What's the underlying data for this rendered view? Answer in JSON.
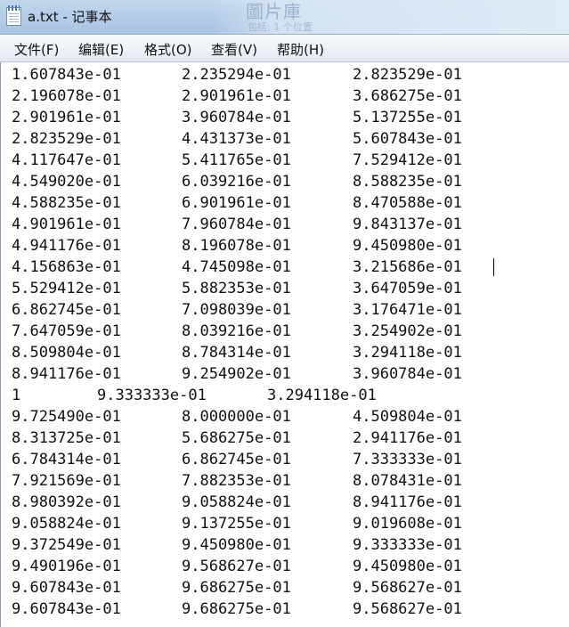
{
  "window": {
    "title": "a.txt - 记事本",
    "icon": "notepad-icon"
  },
  "background_window": {
    "line1": "圖片庫",
    "line2": "包括: 1 个位置"
  },
  "menu": [
    {
      "label": "文件(F)"
    },
    {
      "label": "编辑(E)"
    },
    {
      "label": "格式(O)"
    },
    {
      "label": "查看(V)"
    },
    {
      "label": "帮助(H)"
    }
  ],
  "editor": {
    "rows": [
      [
        "1.607843e-01",
        "2.235294e-01",
        "2.823529e-01"
      ],
      [
        "2.196078e-01",
        "2.901961e-01",
        "3.686275e-01"
      ],
      [
        "2.901961e-01",
        "3.960784e-01",
        "5.137255e-01"
      ],
      [
        "2.823529e-01",
        "4.431373e-01",
        "5.607843e-01"
      ],
      [
        "4.117647e-01",
        "5.411765e-01",
        "7.529412e-01"
      ],
      [
        "4.549020e-01",
        "6.039216e-01",
        "8.588235e-01"
      ],
      [
        "4.588235e-01",
        "6.901961e-01",
        "8.470588e-01"
      ],
      [
        "4.901961e-01",
        "7.960784e-01",
        "9.843137e-01"
      ],
      [
        "4.941176e-01",
        "8.196078e-01",
        "9.450980e-01"
      ],
      [
        "4.156863e-01",
        "4.745098e-01",
        "3.215686e-01"
      ],
      [
        "5.529412e-01",
        "5.882353e-01",
        "3.647059e-01"
      ],
      [
        "6.862745e-01",
        "7.098039e-01",
        "3.176471e-01"
      ],
      [
        "7.647059e-01",
        "8.039216e-01",
        "3.254902e-01"
      ],
      [
        "8.509804e-01",
        "8.784314e-01",
        "3.294118e-01"
      ],
      [
        "8.941176e-01",
        "9.254902e-01",
        "3.960784e-01"
      ],
      [
        "1",
        "9.333333e-01",
        "3.294118e-01"
      ],
      [
        "9.725490e-01",
        "8.000000e-01",
        "4.509804e-01"
      ],
      [
        "8.313725e-01",
        "5.686275e-01",
        "2.941176e-01"
      ],
      [
        "6.784314e-01",
        "6.862745e-01",
        "7.333333e-01"
      ],
      [
        "7.921569e-01",
        "7.882353e-01",
        "8.078431e-01"
      ],
      [
        "8.980392e-01",
        "9.058824e-01",
        "8.941176e-01"
      ],
      [
        "9.058824e-01",
        "9.137255e-01",
        "9.019608e-01"
      ],
      [
        "9.372549e-01",
        "9.450980e-01",
        "9.333333e-01"
      ],
      [
        "9.490196e-01",
        "9.568627e-01",
        "9.450980e-01"
      ],
      [
        "9.607843e-01",
        "9.686275e-01",
        "9.568627e-01"
      ],
      [
        "9.607843e-01",
        "9.686275e-01",
        "9.568627e-01"
      ]
    ]
  }
}
